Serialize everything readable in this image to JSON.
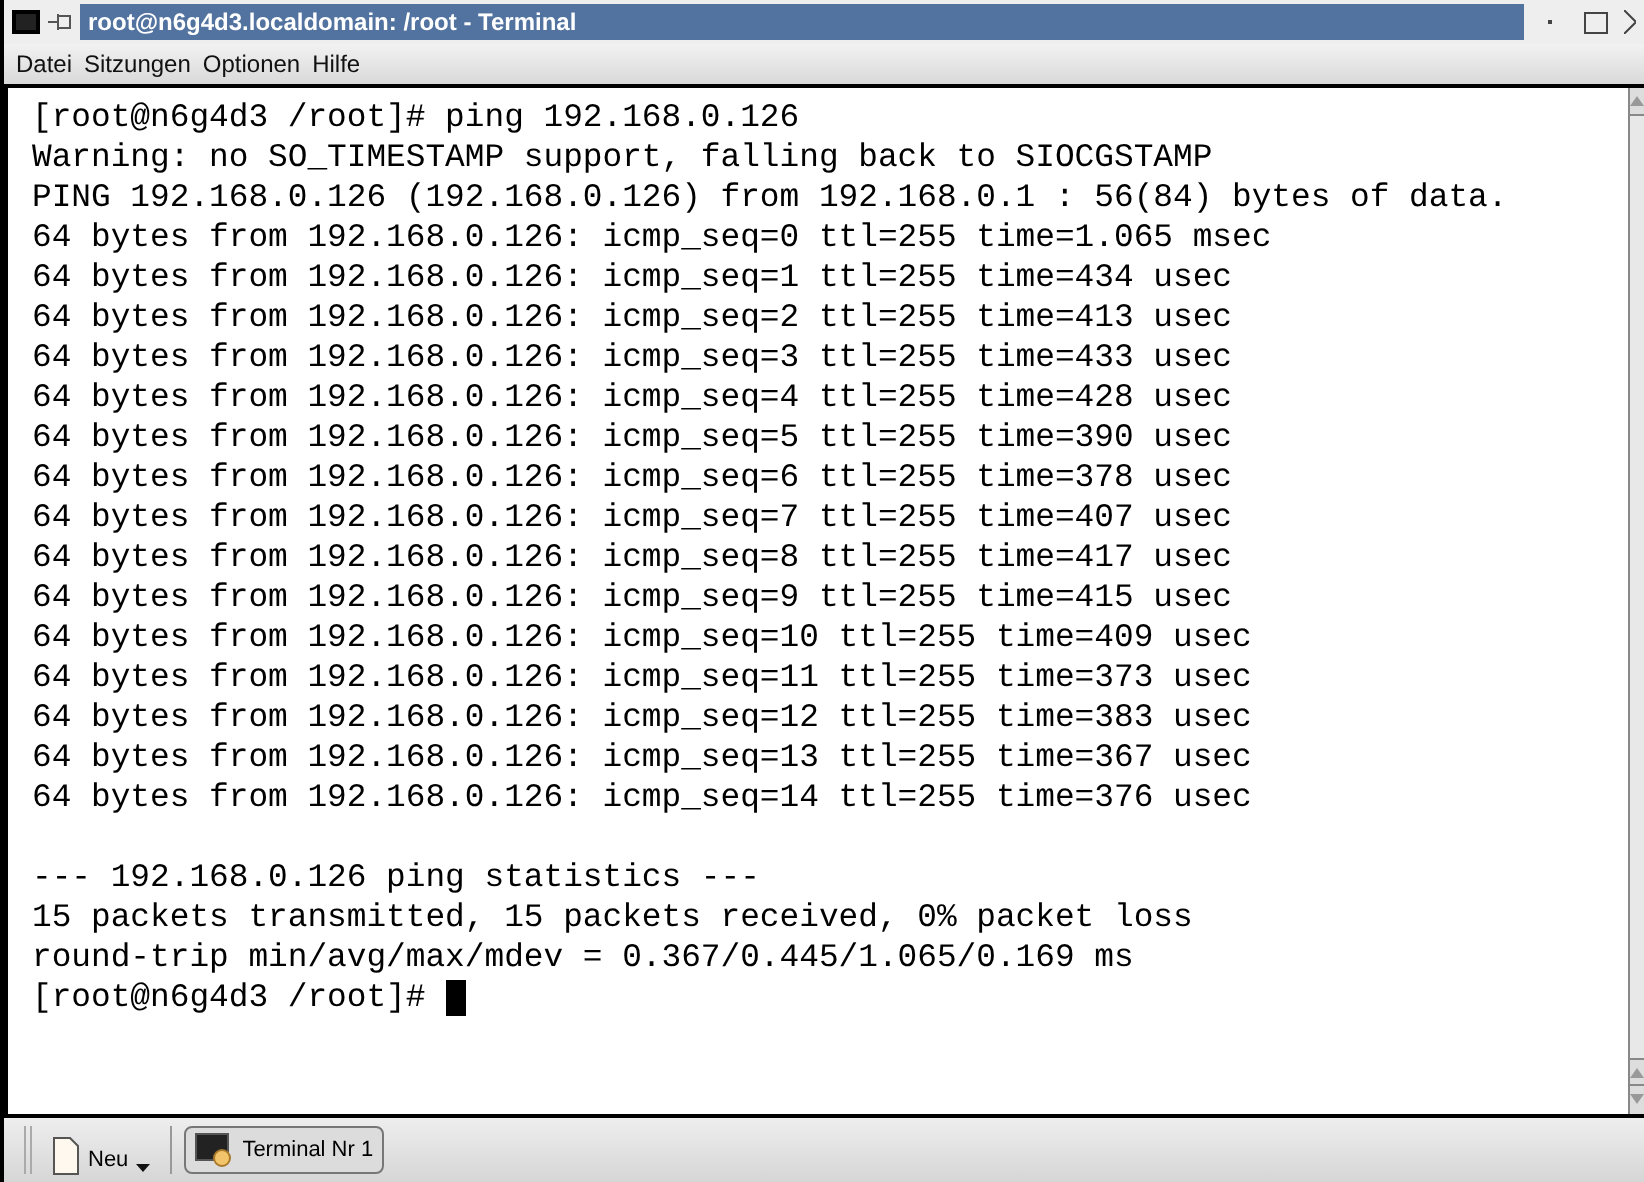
{
  "window": {
    "title": "root@n6g4d3.localdomain: /root - Terminal"
  },
  "menu": [
    "Datei",
    "Sitzungen",
    "Optionen",
    "Hilfe"
  ],
  "terminal": {
    "lines": [
      "[root@n6g4d3 /root]# ping 192.168.0.126",
      "Warning: no SO_TIMESTAMP support, falling back to SIOCGSTAMP",
      "PING 192.168.0.126 (192.168.0.126) from 192.168.0.1 : 56(84) bytes of data.",
      "64 bytes from 192.168.0.126: icmp_seq=0 ttl=255 time=1.065 msec",
      "64 bytes from 192.168.0.126: icmp_seq=1 ttl=255 time=434 usec",
      "64 bytes from 192.168.0.126: icmp_seq=2 ttl=255 time=413 usec",
      "64 bytes from 192.168.0.126: icmp_seq=3 ttl=255 time=433 usec",
      "64 bytes from 192.168.0.126: icmp_seq=4 ttl=255 time=428 usec",
      "64 bytes from 192.168.0.126: icmp_seq=5 ttl=255 time=390 usec",
      "64 bytes from 192.168.0.126: icmp_seq=6 ttl=255 time=378 usec",
      "64 bytes from 192.168.0.126: icmp_seq=7 ttl=255 time=407 usec",
      "64 bytes from 192.168.0.126: icmp_seq=8 ttl=255 time=417 usec",
      "64 bytes from 192.168.0.126: icmp_seq=9 ttl=255 time=415 usec",
      "64 bytes from 192.168.0.126: icmp_seq=10 ttl=255 time=409 usec",
      "64 bytes from 192.168.0.126: icmp_seq=11 ttl=255 time=373 usec",
      "64 bytes from 192.168.0.126: icmp_seq=12 ttl=255 time=383 usec",
      "64 bytes from 192.168.0.126: icmp_seq=13 ttl=255 time=367 usec",
      "64 bytes from 192.168.0.126: icmp_seq=14 ttl=255 time=376 usec"
    ],
    "summary_lines": [
      "--- 192.168.0.126 ping statistics ---",
      "15 packets transmitted, 15 packets received, 0% packet loss",
      "round-trip min/avg/max/mdev = 0.367/0.445/1.065/0.169 ms",
      "[root@n6g4d3 /root]#"
    ]
  },
  "taskbar": {
    "new_button": "Neu",
    "tabs": [
      {
        "label": "Terminal Nr 1",
        "selected": true
      }
    ]
  }
}
